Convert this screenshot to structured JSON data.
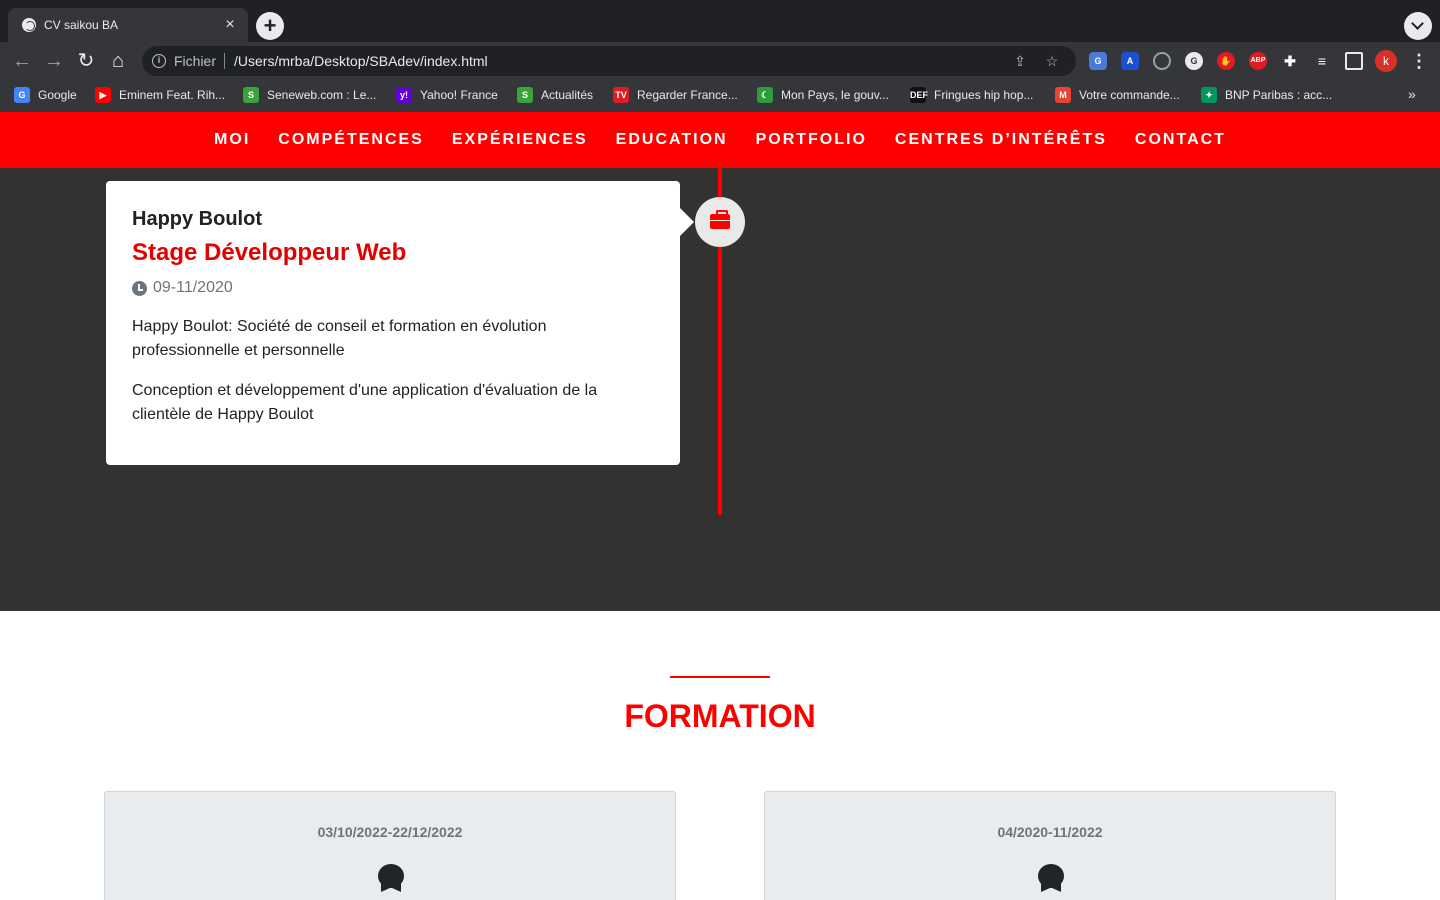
{
  "browser": {
    "tab_title": "CV saikou BA",
    "close_glyph": "×",
    "new_tab_glyph": "+",
    "scheme_label": "Fichier",
    "url": "/Users/mrba/Desktop/SBAdev/index.html",
    "profile_initial": "k",
    "bookmarks": [
      {
        "label": "Google",
        "icon": "google-favicon",
        "color": "#4285f4",
        "glyph": "G"
      },
      {
        "label": "Eminem Feat. Rih...",
        "icon": "youtube-favicon",
        "color": "#ff0000",
        "glyph": "▶"
      },
      {
        "label": "Seneweb.com : Le...",
        "icon": "seneweb-favicon",
        "color": "#3aa43b",
        "glyph": "S"
      },
      {
        "label": "Yahoo! France",
        "icon": "yahoo-favicon",
        "color": "#6001d2",
        "glyph": "y!"
      },
      {
        "label": "Actualités",
        "icon": "news-favicon",
        "color": "#3aa43b",
        "glyph": "S"
      },
      {
        "label": "Regarder France...",
        "icon": "tv-favicon",
        "color": "#e01b22",
        "glyph": "TV"
      },
      {
        "label": "Mon Pays, le gouv...",
        "icon": "flag-favicon",
        "color": "#2b9d3b",
        "glyph": "☾"
      },
      {
        "label": "Fringues hip hop...",
        "icon": "def-favicon",
        "color": "#111111",
        "glyph": "DEF"
      },
      {
        "label": "Votre commande...",
        "icon": "gmail-favicon",
        "color": "#ea4335",
        "glyph": "M"
      },
      {
        "label": "BNP Paribas : acc...",
        "icon": "bnp-favicon",
        "color": "#00965e",
        "glyph": "✦"
      }
    ]
  },
  "nav": {
    "items": [
      "MOI",
      "COMPÉTENCES",
      "EXPÉRIENCES",
      "EDUCATION",
      "PORTFOLIO",
      "CENTRES D’INTÉRÊTS",
      "CONTACT"
    ]
  },
  "experience": {
    "company": "Happy Boulot",
    "role": "Stage Développeur Web",
    "date": "09-11/2020",
    "description_1": "Happy Boulot: Société de conseil et formation en évolution professionnelle et personnelle",
    "description_2": "Conception et développement d'une application d'évaluation de la clientèle de Happy Boulot"
  },
  "formation": {
    "title": "FORMATION",
    "cards": [
      {
        "date": "03/10/2022-22/12/2022"
      },
      {
        "date": "04/2020-11/2022"
      }
    ]
  },
  "colors": {
    "accent": "#ff0000",
    "dark_bg": "#343131"
  }
}
